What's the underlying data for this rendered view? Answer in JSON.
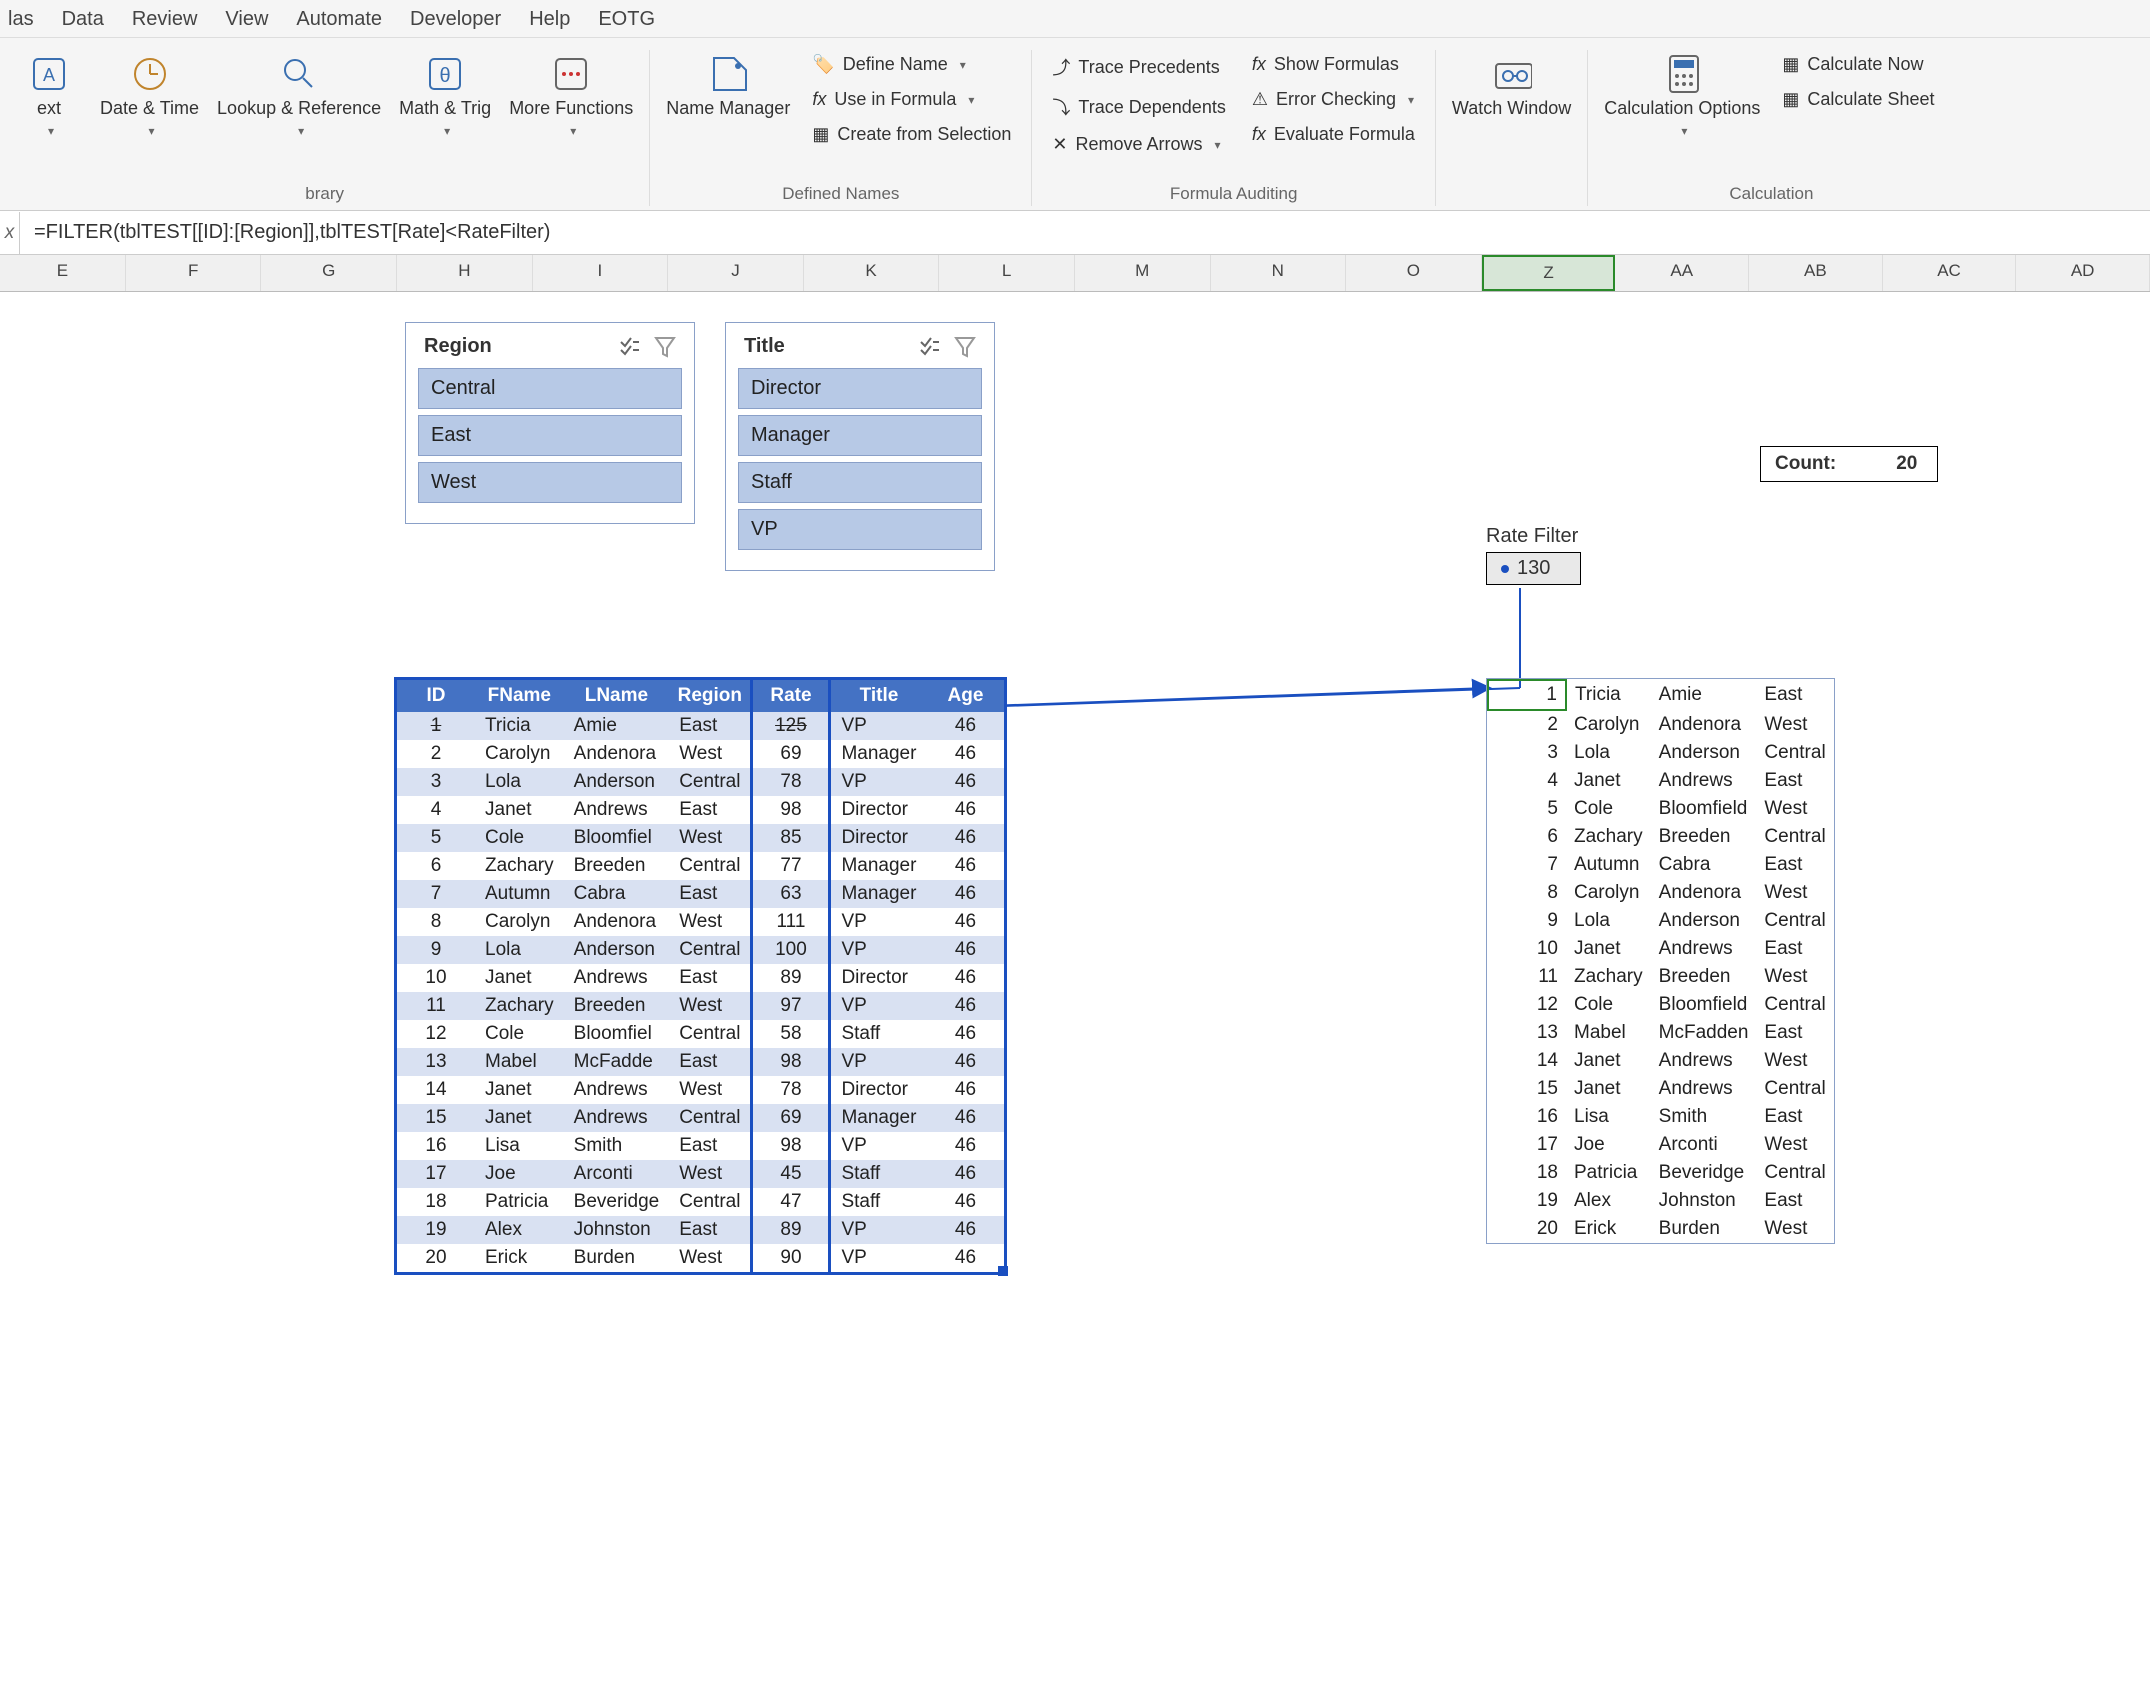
{
  "menu": [
    "las",
    "Data",
    "Review",
    "View",
    "Automate",
    "Developer",
    "Help",
    "EOTG"
  ],
  "ribbon": {
    "library_group": "brary",
    "btns": {
      "text": "ext",
      "datetime": "Date & Time",
      "lookup": "Lookup & Reference",
      "mathtrig": "Math & Trig",
      "morefn": "More Functions",
      "namemgr": "Name Manager",
      "watch": "Watch Window",
      "calcopt": "Calculation Options",
      "calcnow": "Calculate Now",
      "calcsheet": "Calculate Sheet"
    },
    "defined_names": {
      "define": "Define Name",
      "useinf": "Use in Formula",
      "createfrom": "Create from Selection",
      "group": "Defined Names"
    },
    "auditing": {
      "traceprec": "Trace Precedents",
      "tracedep": "Trace Dependents",
      "removearrows": "Remove Arrows",
      "showfm": "Show Formulas",
      "errorchk": "Error Checking",
      "evalfm": "Evaluate Formula",
      "group": "Formula Auditing"
    },
    "calc_group": "Calculation"
  },
  "formula": "=FILTER(tblTEST[[ID]:[Region]],tblTEST[Rate]<RateFilter)",
  "cols": [
    "E",
    "F",
    "G",
    "H",
    "I",
    "J",
    "K",
    "L",
    "M",
    "N",
    "O",
    "Z",
    "AA",
    "AB",
    "AC",
    "AD"
  ],
  "selected_col": "Z",
  "slicers": {
    "region": {
      "title": "Region",
      "items": [
        "Central",
        "East",
        "West"
      ]
    },
    "title": {
      "title": "Title",
      "items": [
        "Director",
        "Manager",
        "Staff",
        "VP"
      ]
    }
  },
  "count": {
    "label": "Count:",
    "value": 20
  },
  "rate_filter": {
    "label": "Rate Filter",
    "value": 130
  },
  "table": {
    "headers": [
      "ID",
      "FName",
      "LName",
      "Region",
      "Rate",
      "Title",
      "Age"
    ],
    "rows": [
      {
        "id": 1,
        "fn": "Tricia",
        "ln": "Amie",
        "rg": "East",
        "rt": 125,
        "tt": "VP",
        "ag": 46,
        "strike": true
      },
      {
        "id": 2,
        "fn": "Carolyn",
        "ln": "Andenora",
        "rg": "West",
        "rt": 69,
        "tt": "Manager",
        "ag": 46
      },
      {
        "id": 3,
        "fn": "Lola",
        "ln": "Anderson",
        "rg": "Central",
        "rt": 78,
        "tt": "VP",
        "ag": 46
      },
      {
        "id": 4,
        "fn": "Janet",
        "ln": "Andrews",
        "rg": "East",
        "rt": 98,
        "tt": "Director",
        "ag": 46
      },
      {
        "id": 5,
        "fn": "Cole",
        "ln": "Bloomfiel",
        "rg": "West",
        "rt": 85,
        "tt": "Director",
        "ag": 46
      },
      {
        "id": 6,
        "fn": "Zachary",
        "ln": "Breeden",
        "rg": "Central",
        "rt": 77,
        "tt": "Manager",
        "ag": 46
      },
      {
        "id": 7,
        "fn": "Autumn",
        "ln": "Cabra",
        "rg": "East",
        "rt": 63,
        "tt": "Manager",
        "ag": 46
      },
      {
        "id": 8,
        "fn": "Carolyn",
        "ln": "Andenora",
        "rg": "West",
        "rt": 111,
        "tt": "VP",
        "ag": 46
      },
      {
        "id": 9,
        "fn": "Lola",
        "ln": "Anderson",
        "rg": "Central",
        "rt": 100,
        "tt": "VP",
        "ag": 46
      },
      {
        "id": 10,
        "fn": "Janet",
        "ln": "Andrews",
        "rg": "East",
        "rt": 89,
        "tt": "Director",
        "ag": 46
      },
      {
        "id": 11,
        "fn": "Zachary",
        "ln": "Breeden",
        "rg": "West",
        "rt": 97,
        "tt": "VP",
        "ag": 46
      },
      {
        "id": 12,
        "fn": "Cole",
        "ln": "Bloomfiel",
        "rg": "Central",
        "rt": 58,
        "tt": "Staff",
        "ag": 46
      },
      {
        "id": 13,
        "fn": "Mabel",
        "ln": "McFadde",
        "rg": "East",
        "rt": 98,
        "tt": "VP",
        "ag": 46
      },
      {
        "id": 14,
        "fn": "Janet",
        "ln": "Andrews",
        "rg": "West",
        "rt": 78,
        "tt": "Director",
        "ag": 46
      },
      {
        "id": 15,
        "fn": "Janet",
        "ln": "Andrews",
        "rg": "Central",
        "rt": 69,
        "tt": "Manager",
        "ag": 46
      },
      {
        "id": 16,
        "fn": "Lisa",
        "ln": "Smith",
        "rg": "East",
        "rt": 98,
        "tt": "VP",
        "ag": 46
      },
      {
        "id": 17,
        "fn": "Joe",
        "ln": "Arconti",
        "rg": "West",
        "rt": 45,
        "tt": "Staff",
        "ag": 46
      },
      {
        "id": 18,
        "fn": "Patricia",
        "ln": "Beveridge",
        "rg": "Central",
        "rt": 47,
        "tt": "Staff",
        "ag": 46
      },
      {
        "id": 19,
        "fn": "Alex",
        "ln": "Johnston",
        "rg": "East",
        "rt": 89,
        "tt": "VP",
        "ag": 46
      },
      {
        "id": 20,
        "fn": "Erick",
        "ln": "Burden",
        "rg": "West",
        "rt": 90,
        "tt": "VP",
        "ag": 46
      }
    ]
  },
  "table2": {
    "rows": [
      {
        "id": 1,
        "fn": "Tricia",
        "ln": "Amie",
        "rg": "East"
      },
      {
        "id": 2,
        "fn": "Carolyn",
        "ln": "Andenora",
        "rg": "West"
      },
      {
        "id": 3,
        "fn": "Lola",
        "ln": "Anderson",
        "rg": "Central"
      },
      {
        "id": 4,
        "fn": "Janet",
        "ln": "Andrews",
        "rg": "East"
      },
      {
        "id": 5,
        "fn": "Cole",
        "ln": "Bloomfield",
        "rg": "West"
      },
      {
        "id": 6,
        "fn": "Zachary",
        "ln": "Breeden",
        "rg": "Central"
      },
      {
        "id": 7,
        "fn": "Autumn",
        "ln": "Cabra",
        "rg": "East"
      },
      {
        "id": 8,
        "fn": "Carolyn",
        "ln": "Andenora",
        "rg": "West"
      },
      {
        "id": 9,
        "fn": "Lola",
        "ln": "Anderson",
        "rg": "Central"
      },
      {
        "id": 10,
        "fn": "Janet",
        "ln": "Andrews",
        "rg": "East"
      },
      {
        "id": 11,
        "fn": "Zachary",
        "ln": "Breeden",
        "rg": "West"
      },
      {
        "id": 12,
        "fn": "Cole",
        "ln": "Bloomfield",
        "rg": "Central"
      },
      {
        "id": 13,
        "fn": "Mabel",
        "ln": "McFadden",
        "rg": "East"
      },
      {
        "id": 14,
        "fn": "Janet",
        "ln": "Andrews",
        "rg": "West"
      },
      {
        "id": 15,
        "fn": "Janet",
        "ln": "Andrews",
        "rg": "Central"
      },
      {
        "id": 16,
        "fn": "Lisa",
        "ln": "Smith",
        "rg": "East"
      },
      {
        "id": 17,
        "fn": "Joe",
        "ln": "Arconti",
        "rg": "West"
      },
      {
        "id": 18,
        "fn": "Patricia",
        "ln": "Beveridge",
        "rg": "Central"
      },
      {
        "id": 19,
        "fn": "Alex",
        "ln": "Johnston",
        "rg": "East"
      },
      {
        "id": 20,
        "fn": "Erick",
        "ln": "Burden",
        "rg": "West"
      }
    ]
  }
}
